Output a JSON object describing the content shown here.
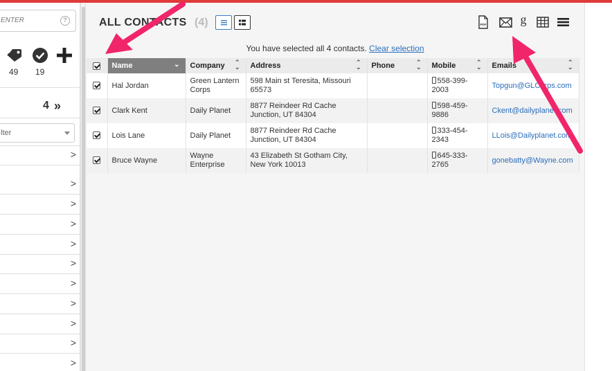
{
  "sidebar": {
    "search_placeholder": "ENTER",
    "tag_count": "49",
    "check_count": "19",
    "page_count": "4",
    "filter_label": "lter"
  },
  "header": {
    "title": "ALL CONTACTS",
    "count": "(4)"
  },
  "selection": {
    "message": "You have selected all 4 contacts.",
    "clear_label": "Clear selection"
  },
  "table": {
    "columns": [
      "Name",
      "Company",
      "Address",
      "Phone",
      "Mobile",
      "Emails"
    ],
    "rows": [
      {
        "name": "Hal Jordan",
        "company": "Green Lantern Corps",
        "address": "598 Main st Teresita, Missouri 65573",
        "phone": "",
        "mobile": "558-399-2003",
        "email": "Topgun@GLCorps.com"
      },
      {
        "name": "Clark Kent",
        "company": "Daily Planet",
        "address": "8877 Reindeer Rd Cache Junction, UT 84304",
        "phone": "",
        "mobile": "598-459-9886",
        "email": "Ckent@dailyplanet.com"
      },
      {
        "name": "Lois Lane",
        "company": "Daily Planet",
        "address": "8877 Reindeer Rd Cache Junction, UT 84304",
        "phone": "",
        "mobile": "333-454-2343",
        "email": "LLois@Dailyplanet.com"
      },
      {
        "name": "Bruce Wayne",
        "company": "Wayne Enterprise",
        "address": "43 Elizabeth St Gotham City, New York 10013",
        "phone": "",
        "mobile": "645-333-2765",
        "email": "gonebatty@Wayne.com"
      }
    ]
  },
  "icons": {
    "pdf": "pdf-icon",
    "email": "envelope-icon",
    "google": "google-icon",
    "table": "table-icon",
    "menu": "menu-icon"
  },
  "colors": {
    "accent": "#2a6ebb",
    "arrow": "#f0256a",
    "top_bar": "#e03a3a",
    "sorted_header": "#7f7f7f"
  }
}
